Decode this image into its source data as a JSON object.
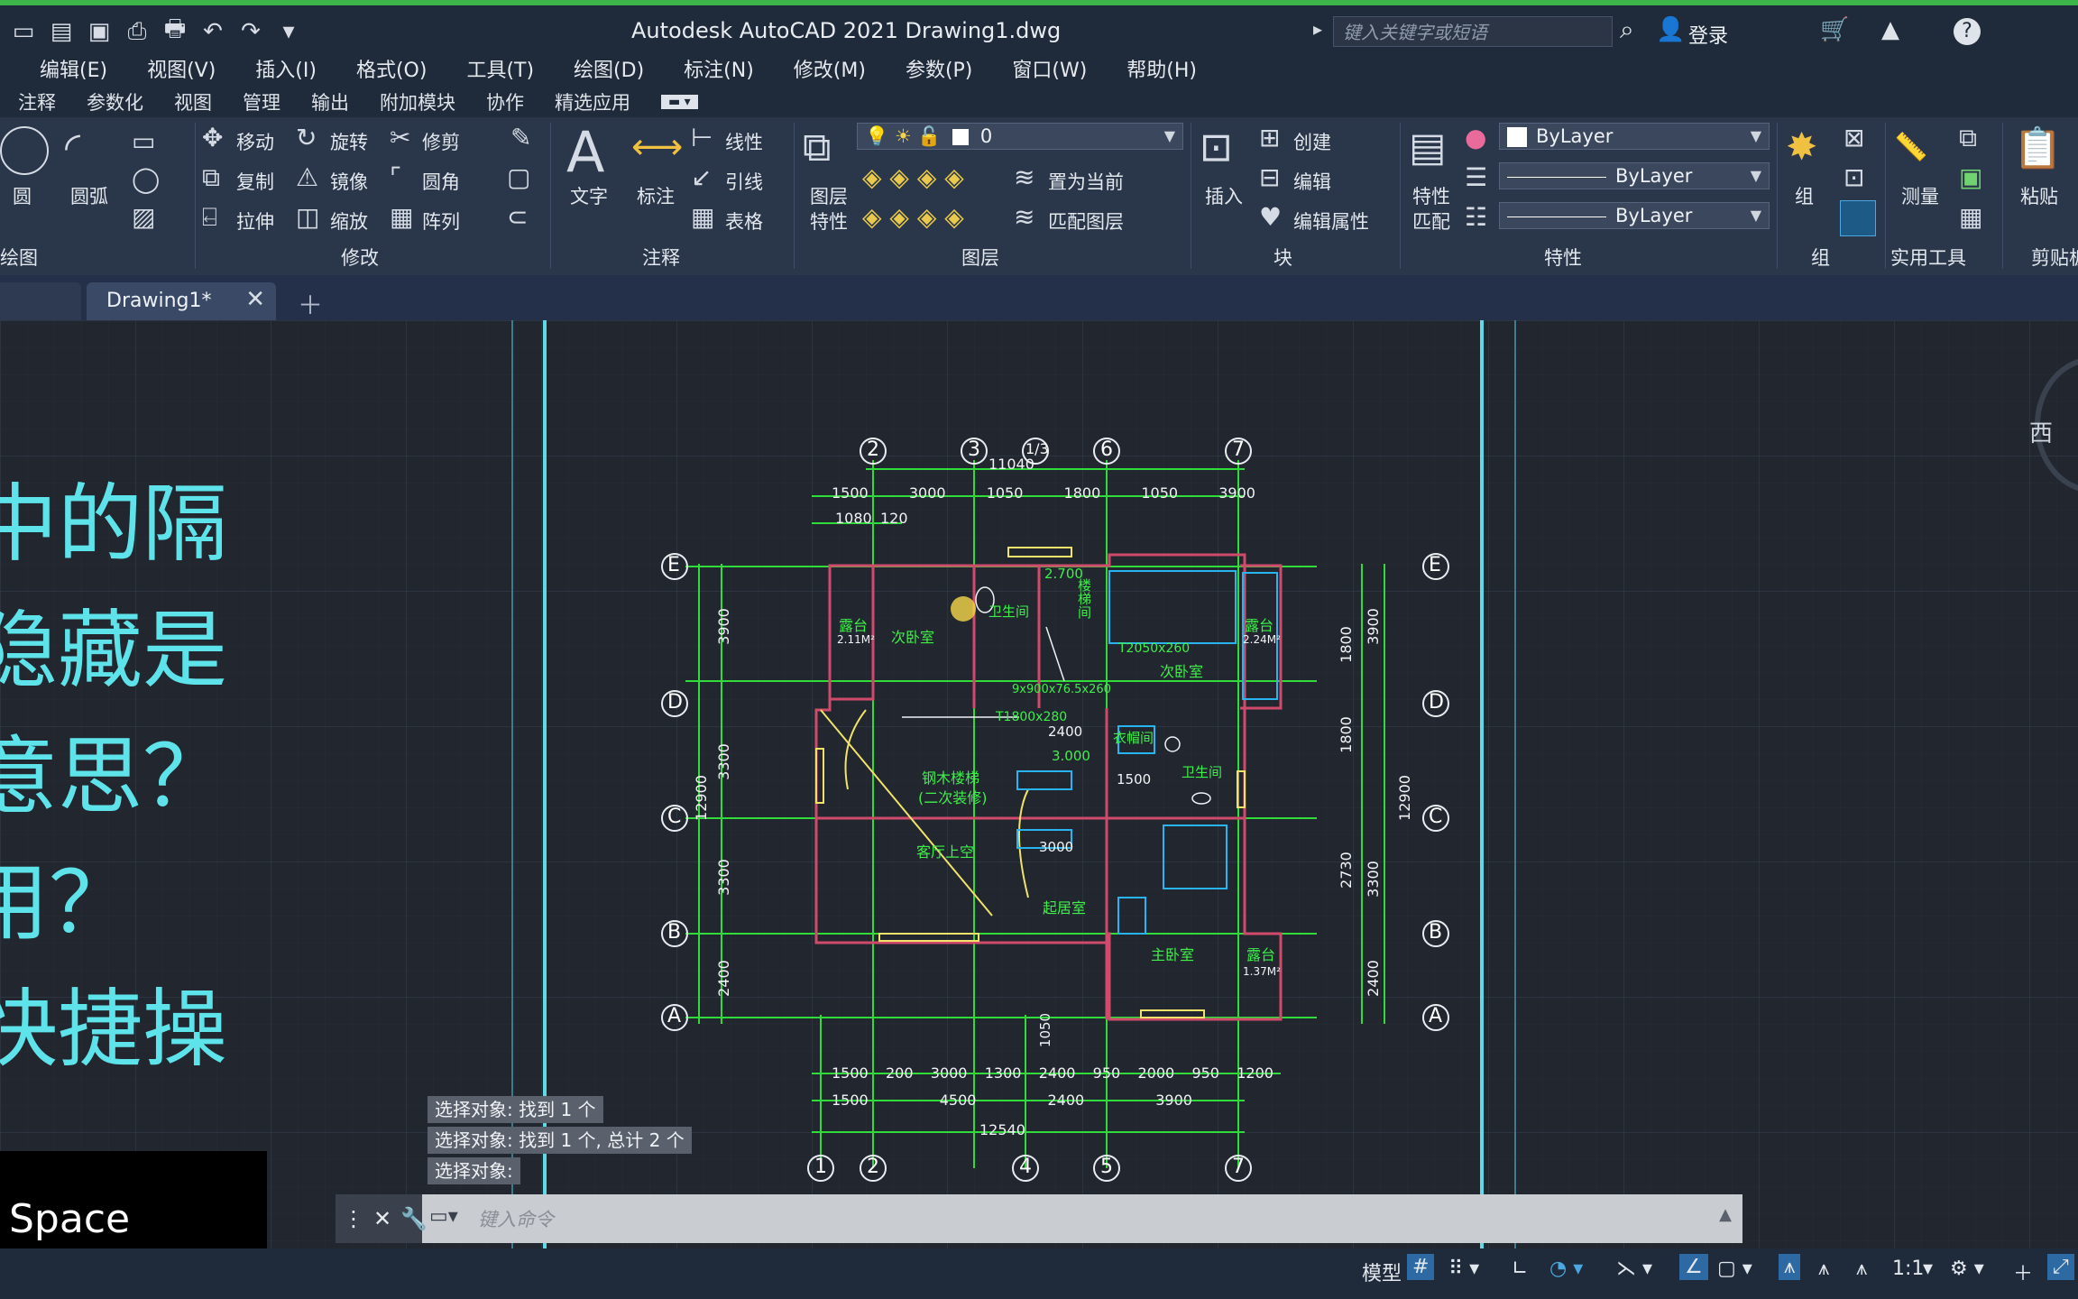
{
  "window": {
    "title": "Autodesk AutoCAD 2021    Drawing1.dwg",
    "search_placeholder": "键入关键字或短语",
    "login_label": "登录"
  },
  "menu": [
    "编辑(E)",
    "视图(V)",
    "插入(I)",
    "格式(O)",
    "工具(T)",
    "绘图(D)",
    "标注(N)",
    "修改(M)",
    "参数(P)",
    "窗口(W)",
    "帮助(H)"
  ],
  "ribbon_tabs": [
    "注释",
    "参数化",
    "视图",
    "管理",
    "输出",
    "附加模块",
    "协作",
    "精选应用"
  ],
  "ribbon": {
    "draw": {
      "circle": "圆",
      "arc": "圆弧",
      "footer": "绘图"
    },
    "modify": {
      "move": "移动",
      "rotate": "旋转",
      "trim": "修剪",
      "copy": "复制",
      "mirror": "镜像",
      "fillet": "圆角",
      "stretch": "拉伸",
      "scale": "缩放",
      "array": "阵列",
      "footer": "修改"
    },
    "annotation": {
      "text": "文字",
      "dimension": "标注",
      "linear": "线性",
      "leader": "引线",
      "table": "表格",
      "footer": "注释"
    },
    "layers": {
      "props_line1": "图层",
      "props_line2": "特性",
      "current_layer": "0",
      "set_current": "置为当前",
      "match_layer": "匹配图层",
      "footer": "图层"
    },
    "block": {
      "insert": "插入",
      "create": "创建",
      "edit": "编辑",
      "edit_attr": "编辑属性",
      "footer": "块"
    },
    "properties": {
      "match_line1": "特性",
      "match_line2": "匹配",
      "color": "ByLayer",
      "linetype": "ByLayer",
      "lineweight": "ByLayer",
      "footer": "特性"
    },
    "groups": {
      "group": "组",
      "footer": "组"
    },
    "utilities": {
      "measure": "测量",
      "footer": "实用工具"
    },
    "clipboard": {
      "paste": "粘贴",
      "footer": "剪贴板"
    }
  },
  "doc_tab": {
    "name": "Drawing1*"
  },
  "overlay_text": [
    "中的隔",
    "隐藏是",
    "意思？",
    "用？",
    "快捷操"
  ],
  "viewcube": {
    "direction": "西"
  },
  "plan": {
    "axes_top": [
      "2",
      "3",
      "1/3",
      "6",
      "7"
    ],
    "axes_bottom": [
      "1",
      "2",
      "4",
      "5",
      "7"
    ],
    "axes_side": [
      "E",
      "D",
      "C",
      "B",
      "A"
    ],
    "dims_top_total": "11040",
    "dims_top_row": [
      "1500",
      "3000",
      "1050",
      "1800",
      "1050",
      "3900"
    ],
    "dims_top_small": [
      "1080",
      "120"
    ],
    "dims_bottom_total": "12540",
    "dims_bottom_row1": [
      "1500",
      "200",
      "3000",
      "1300",
      "2400",
      "950",
      "2000",
      "950",
      "1200"
    ],
    "dims_bottom_row2": [
      "1500",
      "4500",
      "2400",
      "3900"
    ],
    "dims_left_total": "12900",
    "dims_left": [
      "3900",
      "3300",
      "3300",
      "2400"
    ],
    "dims_right_total": "12900",
    "dims_right": [
      "3900",
      "1800",
      "1800",
      "2730",
      "3300",
      "2400"
    ],
    "rooms": [
      "露台",
      "次卧室",
      "卫生间",
      "楼梯间",
      "次卧室",
      "露台",
      "钢木楼梯",
      "(二次装修)",
      "客厅上空",
      "起居室",
      "衣帽间",
      "卫生间",
      "主卧室",
      "露台"
    ],
    "notes": [
      "2.700",
      "3.000",
      "2.11M²",
      "2.24M²",
      "1.37M²",
      "T2050x260",
      "T1800x280",
      "9x900x76.5x260",
      "2400",
      "1500",
      "3000",
      "1050"
    ]
  },
  "command_history": [
    "选择对象: 找到 1 个",
    "选择对象: 找到 1 个, 总计 2 个",
    "选择对象:"
  ],
  "keypress": "Space",
  "command_placeholder": "键入命令",
  "status": {
    "model": "模型",
    "scale": "1:1"
  }
}
